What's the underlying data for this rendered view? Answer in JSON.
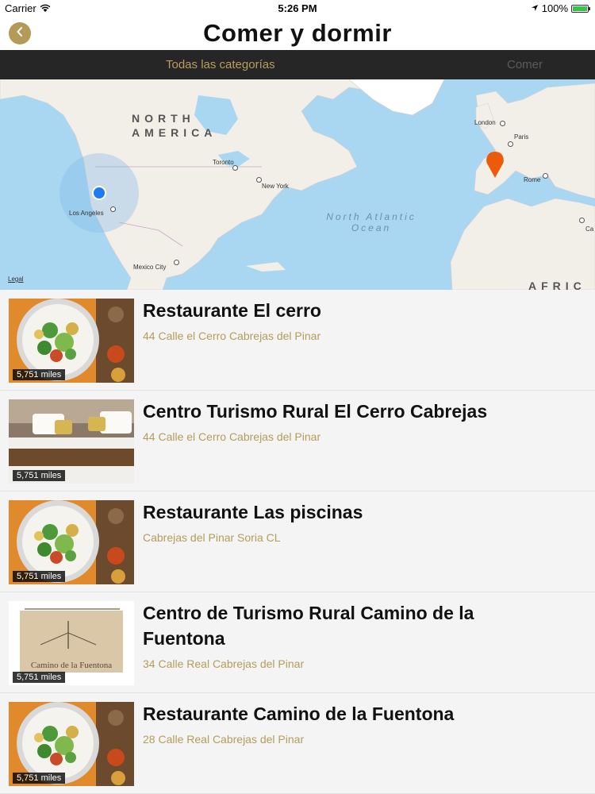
{
  "status": {
    "carrier": "Carrier",
    "time": "5:26 PM",
    "battery": "100%"
  },
  "nav": {
    "title": "Comer y dormir"
  },
  "tabs": {
    "all": "Todas las categorías",
    "eat": "Comer"
  },
  "map": {
    "continent_na": "NORTH AMERICA",
    "continent_af": "AFRIC",
    "ocean": "North Atlantic Ocean",
    "legal": "Legal",
    "cities": [
      "London",
      "Paris",
      "Rome",
      "Toronto",
      "New York",
      "Los Angeles",
      "Mexico City",
      "Ca"
    ]
  },
  "places": [
    {
      "title": "Restaurante El cerro",
      "address": "44 Calle el Cerro Cabrejas del Pinar",
      "distance": "5,751 miles",
      "image": "food"
    },
    {
      "title": "Centro Turismo Rural El Cerro Cabrejas",
      "address": "44 Calle el Cerro Cabrejas del Pinar",
      "distance": "5,751 miles",
      "image": "bed"
    },
    {
      "title": "Restaurante Las piscinas",
      "address": "Cabrejas del Pinar Soria CL",
      "distance": "5,751 miles",
      "image": "food"
    },
    {
      "title": "Centro de Turismo Rural Camino de la Fuentona",
      "address": "34 Calle Real Cabrejas del Pinar",
      "distance": "5,751 miles",
      "image": "sign"
    },
    {
      "title": "Restaurante Camino de la Fuentona",
      "address": "28 Calle Real Cabrejas del Pinar",
      "distance": "5,751 miles",
      "image": "food"
    }
  ],
  "sign_text": "Camino de la Fuentona"
}
